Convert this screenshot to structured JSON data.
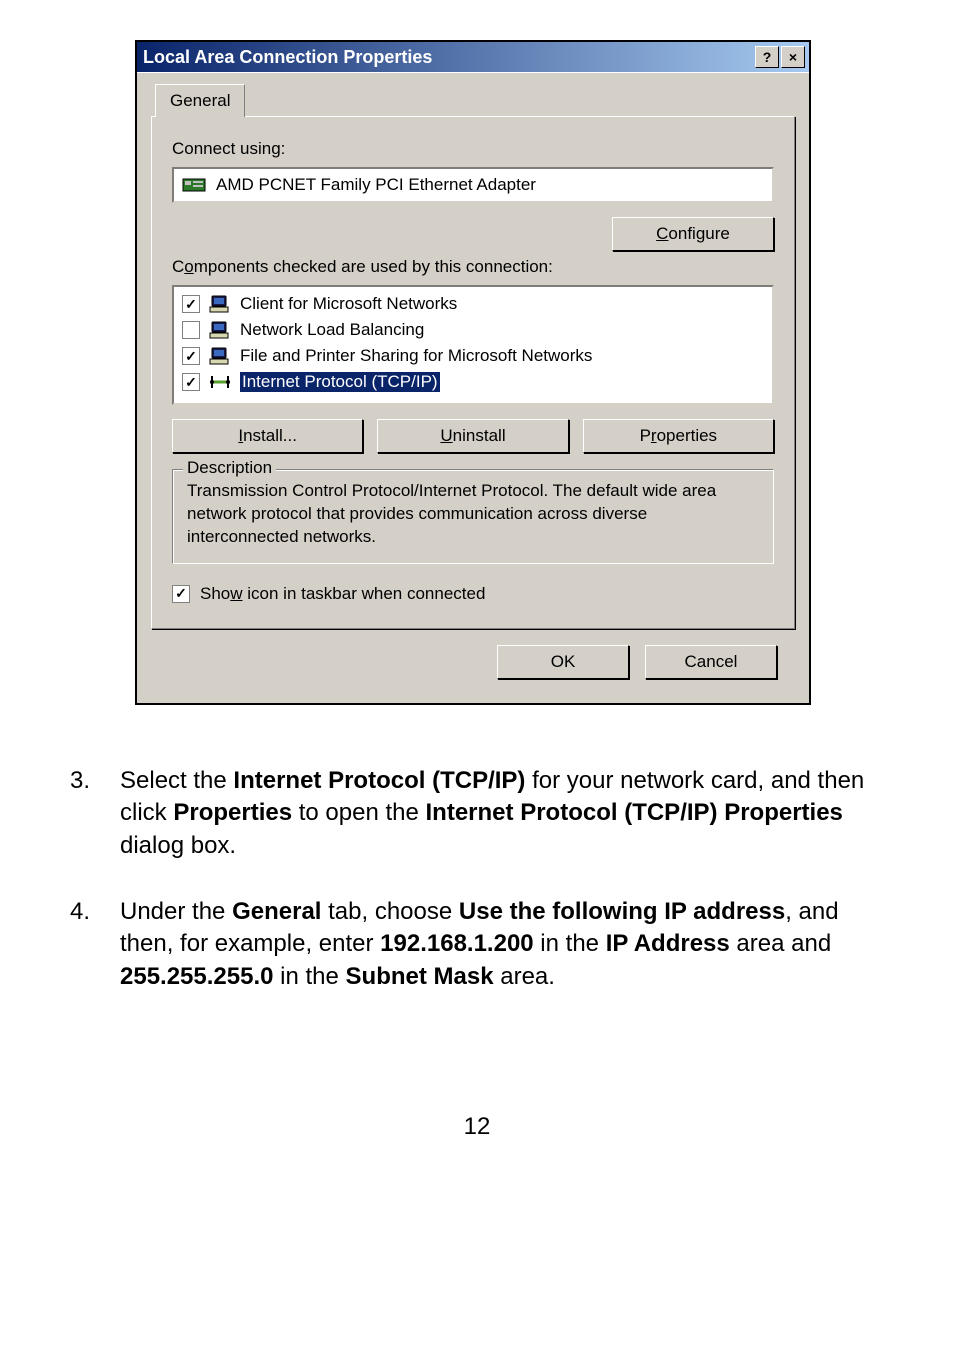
{
  "dialog": {
    "title": "Local Area Connection Properties",
    "tab": "General",
    "connect_using_label": "Connect using:",
    "adapter_name": "AMD PCNET Family PCI Ethernet Adapter",
    "configure_btn": "Configure",
    "components_label": "Components checked are used by this connection:",
    "items": [
      {
        "label": "Client for Microsoft Networks",
        "checked": true
      },
      {
        "label": "Network Load Balancing",
        "checked": false
      },
      {
        "label": "File and Printer Sharing for Microsoft Networks",
        "checked": true
      },
      {
        "label": "Internet Protocol (TCP/IP)",
        "checked": true,
        "selected": true
      }
    ],
    "install_btn": "Install...",
    "uninstall_btn": "Uninstall",
    "properties_btn": "Properties",
    "description_legend": "Description",
    "description_text": "Transmission Control Protocol/Internet Protocol. The default wide area network protocol that provides communication across diverse interconnected networks.",
    "show_icon_label": "Show icon in taskbar when connected",
    "show_icon_checked": true,
    "ok_btn": "OK",
    "cancel_btn": "Cancel"
  },
  "instructions": {
    "step3_num": "3.",
    "step3_a": "Select the ",
    "step3_b": "Internet Protocol (TCP/IP)",
    "step3_c": " for your network card, and then click ",
    "step3_d": "Properties",
    "step3_e": " to open the ",
    "step3_f": "Internet Protocol (TCP/IP) Properties",
    "step3_g": " dialog box.",
    "step4_num": "4.",
    "step4_a": "Under the ",
    "step4_b": "General",
    "step4_c": " tab, choose ",
    "step4_d": "Use the following IP address",
    "step4_e": ", and then, for example, enter ",
    "step4_f": "192.168.1.200",
    "step4_g": " in the ",
    "step4_h": "IP Address",
    "step4_i": " area and ",
    "step4_j": "255.255.255.0",
    "step4_k": " in the ",
    "step4_l": "Subnet Mask",
    "step4_m": " area."
  },
  "page_number": "12"
}
